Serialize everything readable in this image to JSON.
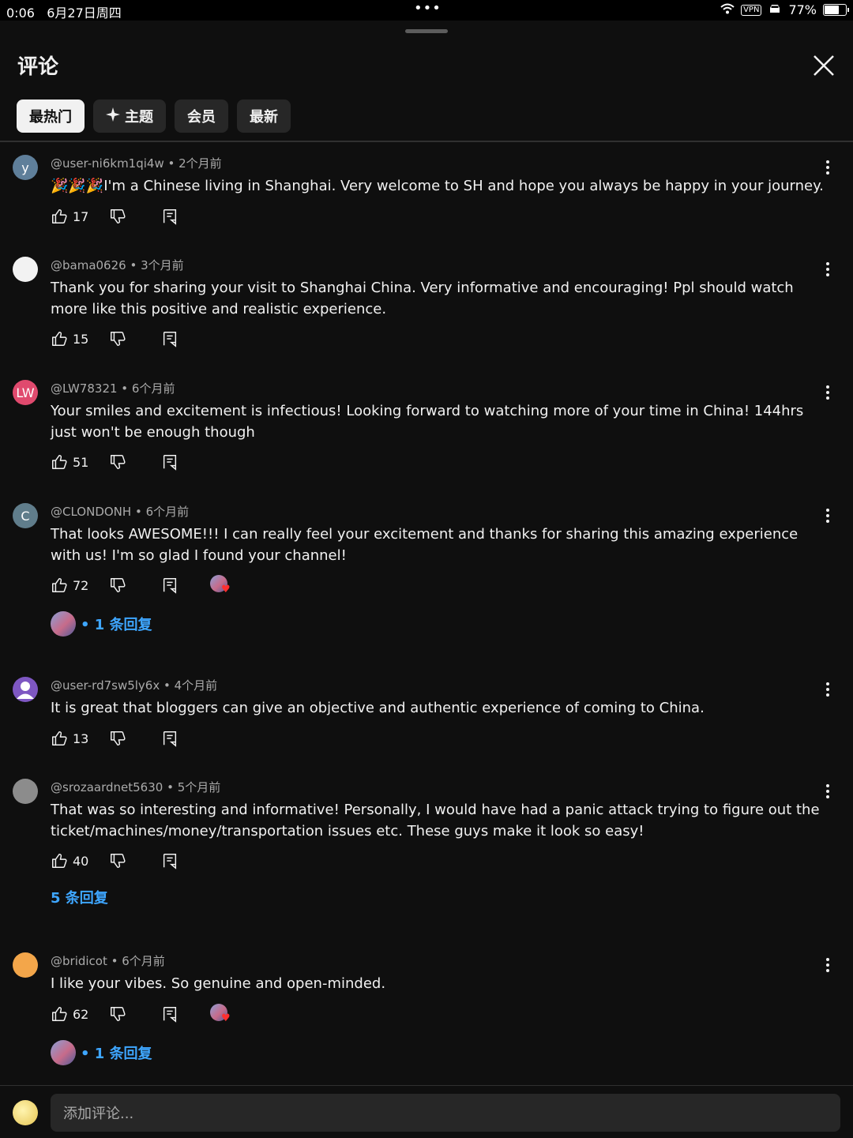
{
  "status_bar": {
    "time": "0:06",
    "date": "6月27日周四",
    "dots": "•••",
    "vpn": "VPN",
    "battery_text": "77%",
    "battery_level": 0.77
  },
  "sheet": {
    "title": "评论"
  },
  "filters": [
    {
      "label": "最热门",
      "active": true
    },
    {
      "label": "主题",
      "icon": "sparkle-icon",
      "active": false
    },
    {
      "label": "会员",
      "active": false
    },
    {
      "label": "最新",
      "active": false
    }
  ],
  "comments": [
    {
      "author": "@user-ni6km1qi4w",
      "time": "2个月前",
      "avatar_letter": "y",
      "avatar_color": "#5f7f9a",
      "text": "🎉🎉🎉I'm a Chinese living in Shanghai. Very welcome to SH and hope you always be happy in your journey.",
      "likes": "17"
    },
    {
      "author": "@bama0626",
      "time": "3个月前",
      "avatar_letter": "",
      "avatar_color": "#f2f2f2",
      "text": "Thank you for sharing your visit to Shanghai China. Very informative and encouraging! Ppl should watch more like this positive and realistic experience.",
      "likes": "15"
    },
    {
      "author": "@LW78321",
      "time": "6个月前",
      "avatar_letter": "LW",
      "avatar_color": "#e04a6e",
      "text": "Your smiles and excitement is infectious! Looking forward to watching more of your time in China! 144hrs just won't be enough though",
      "likes": "51"
    },
    {
      "author": "@CLONDONH",
      "time": "6个月前",
      "avatar_letter": "C",
      "avatar_color": "#607d8b",
      "text": "That looks AWESOME!!! I can really feel your excitement and thanks for sharing this amazing experience with us! I'm so glad I found your channel!",
      "likes": "72",
      "hearted": true,
      "replies": "• 1 条回复"
    },
    {
      "author": "@user-rd7sw5ly6x",
      "time": "4个月前",
      "avatar_letter": "",
      "avatar_color": "#7e57c2",
      "text": "It is great that bloggers can give an objective and authentic experience of coming to China.",
      "likes": "13"
    },
    {
      "author": "@srozaardnet5630",
      "time": "5个月前",
      "avatar_letter": "",
      "avatar_color": "#8c8c8c",
      "text": "That was so interesting and informative!   Personally, I would have had a panic attack trying to figure out the ticket/machines/money/transportation issues etc.  These guys make it look so easy!",
      "likes": "40",
      "replies": "5 条回复"
    },
    {
      "author": "@bridicot",
      "time": "6个月前",
      "avatar_letter": "",
      "avatar_color": "#f3a64a",
      "text": "I like your vibes. So genuine and open-minded.",
      "likes": "62",
      "hearted": true,
      "replies": "• 1 条回复"
    }
  ],
  "composer": {
    "placeholder": "添加评论..."
  },
  "colors": {
    "background": "#0f0f0f",
    "chip": "#272727",
    "link": "#3ea6ff",
    "heart": "#ff2f2f"
  }
}
